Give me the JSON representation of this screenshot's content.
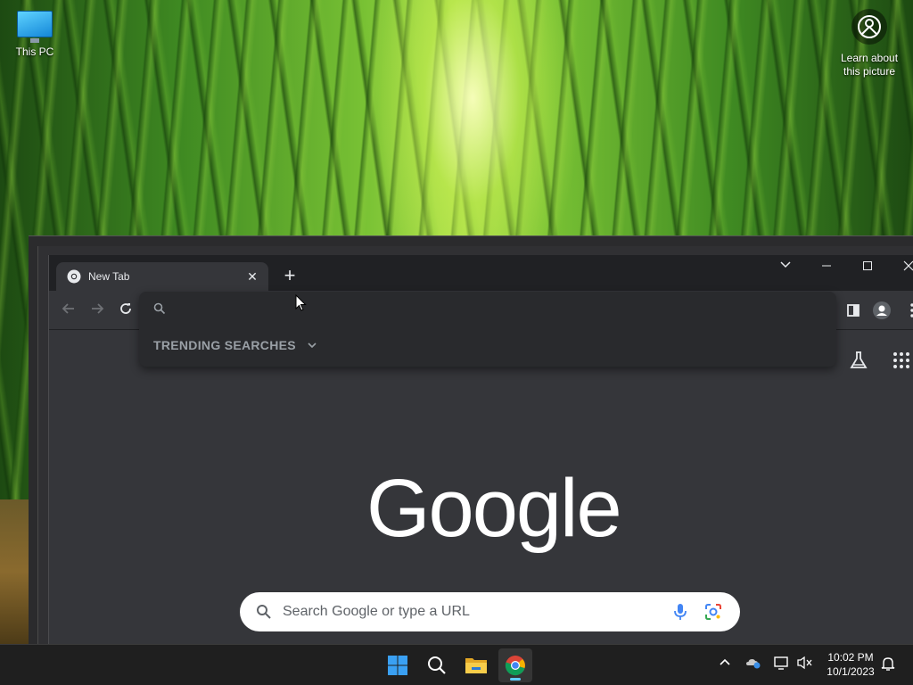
{
  "desktop": {
    "icons": [
      {
        "label": "This PC",
        "icon": "this-pc-icon"
      }
    ],
    "spotlight_label": "Learn about this picture"
  },
  "browser": {
    "tab": {
      "title": "New Tab",
      "favicon": "chrome-icon"
    },
    "controls": {
      "minimize": "minimize-icon",
      "maximize": "maximize-icon",
      "close": "close-icon",
      "tab_search": "chevron-down-icon"
    },
    "omnibox": {
      "value": "",
      "suggestions_header": "TRENDING SEARCHES"
    },
    "ntp": {
      "logo_text": "Google",
      "search_placeholder": "Search Google or type a URL"
    }
  },
  "taskbar": {
    "clock_time": "10:02 PM",
    "clock_date": "10/1/2023",
    "pinned": [
      "start-icon",
      "search-icon",
      "file-explorer-icon",
      "chrome-icon"
    ]
  },
  "colors": {
    "chrome_frame": "#202124",
    "chrome_toolbar": "#35363a",
    "omnibox_dropdown": "#292a2d",
    "taskbar": "#1f1f1f",
    "accent": "#60cdff"
  }
}
